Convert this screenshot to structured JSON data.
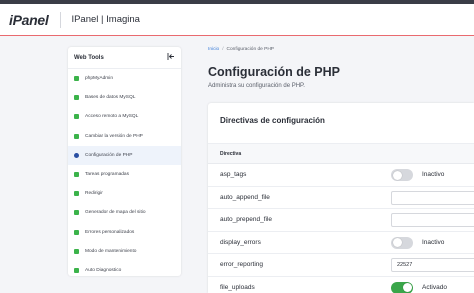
{
  "header": {
    "logo": "iPanel",
    "title": "IPanel | Imagina"
  },
  "sidebar": {
    "title": "Web Tools",
    "collapse_icon": "collapse-left-icon",
    "items": [
      {
        "label": "phpMyAdmin",
        "icon": "user-icon",
        "active": false
      },
      {
        "label": "Bases de datos MySQL",
        "icon": "database-icon",
        "active": false
      },
      {
        "label": "Acceso remoto a MySQL",
        "icon": "wifi-icon",
        "active": false
      },
      {
        "label": "Cambiar la versión de PHP",
        "icon": "code-icon",
        "active": false
      },
      {
        "label": "Configuración de PHP",
        "icon": "toggle-icon",
        "active": true
      },
      {
        "label": "Tareas programadas",
        "icon": "calendar-icon",
        "active": false
      },
      {
        "label": "Redirigir",
        "icon": "redirect-icon",
        "active": false
      },
      {
        "label": "Generador de mapa del sitio",
        "icon": "sitemap-icon",
        "active": false
      },
      {
        "label": "Errores personalizados",
        "icon": "warning-icon",
        "active": false
      },
      {
        "label": "Modo de mantenimiento",
        "icon": "gear-icon",
        "active": false
      },
      {
        "label": "Auto Diagnostico",
        "icon": "refresh-icon",
        "active": false
      }
    ]
  },
  "breadcrumb": {
    "home": "Inicio",
    "separator": "/",
    "current": "Configuración de PHP"
  },
  "page": {
    "title": "Configuración de PHP",
    "subtitle": "Administra su configuración de PHP."
  },
  "card": {
    "title": "Directivas de configuración",
    "column_header": "Directiva",
    "rows": [
      {
        "name": "asp_tags",
        "type": "toggle",
        "on": false,
        "label": "Inactivo"
      },
      {
        "name": "auto_append_file",
        "type": "input",
        "value": ""
      },
      {
        "name": "auto_prepend_file",
        "type": "input",
        "value": ""
      },
      {
        "name": "display_errors",
        "type": "toggle",
        "on": false,
        "label": "Inactivo"
      },
      {
        "name": "error_reporting",
        "type": "input",
        "value": "22527"
      },
      {
        "name": "file_uploads",
        "type": "toggle",
        "on": true,
        "label": "Activado"
      }
    ]
  },
  "colors": {
    "accent_red": "#e96a6f",
    "active_green": "#3aa64a",
    "link_blue": "#3b7dd8",
    "sidebar_active_bg": "#eef3fb"
  }
}
